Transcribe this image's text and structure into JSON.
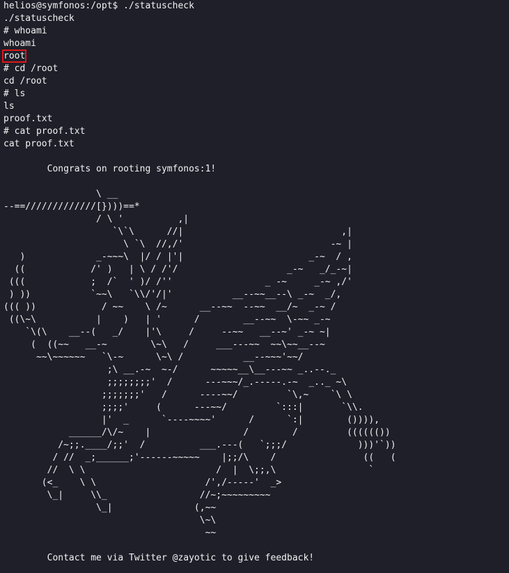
{
  "terminal": {
    "lines": [
      "helios@symfonos:/opt$ ./statuscheck",
      "./statuscheck",
      "# whoami",
      "whoami",
      "root",
      "# cd /root",
      "cd /root",
      "# ls",
      "ls",
      "proof.txt",
      "# cat proof.txt",
      "cat proof.txt"
    ],
    "congrats": "        Congrats on rooting symfonos:1!",
    "ascii_art": "                 \\ __\n--==/////////////[})))==*\n                 / \\ '          ,|\n                    `\\`\\      //|                             ,|\n                      \\ `\\  //,/'                           -~ |\n   )             _-~~~\\  |/ / |'|                       _-~  / ,\n  ((            /' )   | \\ / /'/                    _-~   _/_-~|\n (((            ;  /`  ' )/ /''                 _ -~     _-~ ,/'\n ) ))           `~~\\   `\\\\/'/|'           __--~~__--\\ _-~  _/,\n((( ))            / ~~    \\ /~      __--~~  --~~  __/~  _-~ /\n ((\\~\\           |    )   | '      /        __--~~  \\-~~ _-~\n    `\\(\\    __--(   _/    |'\\     /     --~~   __--~' _-~ ~|\n     (  ((~~   __-~        \\~\\   /     ___---~~  ~~\\~~__--~\n      ~~\\~~~~~~   `\\-~      \\~\\ /           __--~~~'~~/\n                   ;\\ __.-~  ~-/      ~~~~~__\\__---~~ _..--._\n                   ;;;;;;;;'  /      ---~~~/_.-----.-~  _.._ ~\\\n                  ;;;;;;;'   /      ----~~/         `\\,~    `\\ \\\n                  ;;;;'     (      ---~~/         `:::|       `\\\\.\n                  |'  _      `----~~~~'      /      `:|        ()))),\n            ______/\\/~    |                 /        /         (((((())\n          /~;;.____/;;'  /          ___.---(   `;;;/             )))'`))\n         / //  _;______;'------~~~~~    |;;/\\    /                ((   (\n        //  \\ \\                        /  |  \\;;,\\                 `\n       (<_    \\ \\                    /',/-----'  _>\n        \\_|     \\\\_                 //~;~~~~~~~~~\n                 \\_|               (,~~\n                                    \\~\\\n                                     ~~",
    "contact": "        Contact me via Twitter @zayotic to give feedback!",
    "highlight_color": "#e0161b",
    "background_color": "#1e1f29",
    "text_color": "#f2f2f2"
  }
}
